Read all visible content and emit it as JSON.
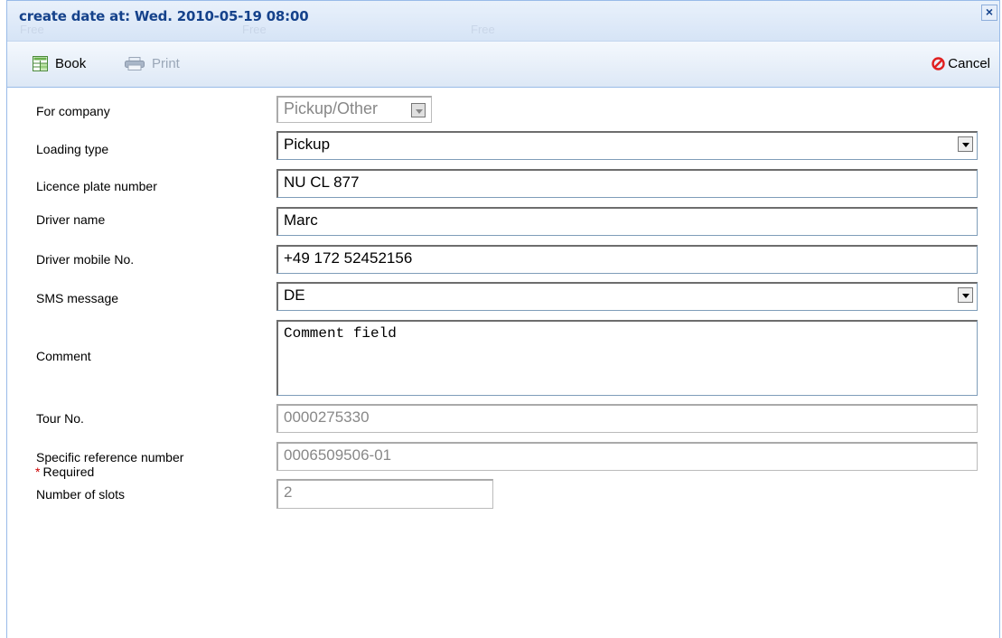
{
  "dialog": {
    "title": "create date at: Wed. 2010-05-19 08:00",
    "ghost_labels": [
      "Free",
      "Free",
      "Free"
    ]
  },
  "toolbar": {
    "book_label": "Book",
    "print_label": "Print",
    "cancel_label": "Cancel"
  },
  "form": {
    "company": {
      "label": "For company",
      "value": "Pickup/Other"
    },
    "loading_type": {
      "label": "Loading type",
      "value": "Pickup"
    },
    "licence_plate": {
      "label": "Licence plate number",
      "value": "NU CL 877"
    },
    "driver_name": {
      "label": "Driver name",
      "value": "Marc"
    },
    "driver_mobile": {
      "label": "Driver mobile No.",
      "value": "+49 172 52452156"
    },
    "sms_message": {
      "label": "SMS message",
      "value": "DE"
    },
    "comment": {
      "label": "Comment",
      "value": "Comment field "
    },
    "tour_no": {
      "label": "Tour No.",
      "value": "0000275330"
    },
    "reference": {
      "label": "Specific reference number",
      "value": "0006509506-01"
    },
    "slots": {
      "label": "Number of slots",
      "value": "2"
    }
  },
  "required_note": {
    "star": "*",
    "text": "Required"
  },
  "colors": {
    "title": "#15428b",
    "cancel_icon": "#e02020",
    "required_star": "#cc0000"
  },
  "icons": [
    "book-grid-icon",
    "printer-icon",
    "cancel-circle-icon",
    "close-icon",
    "dropdown-arrow-icon"
  ]
}
